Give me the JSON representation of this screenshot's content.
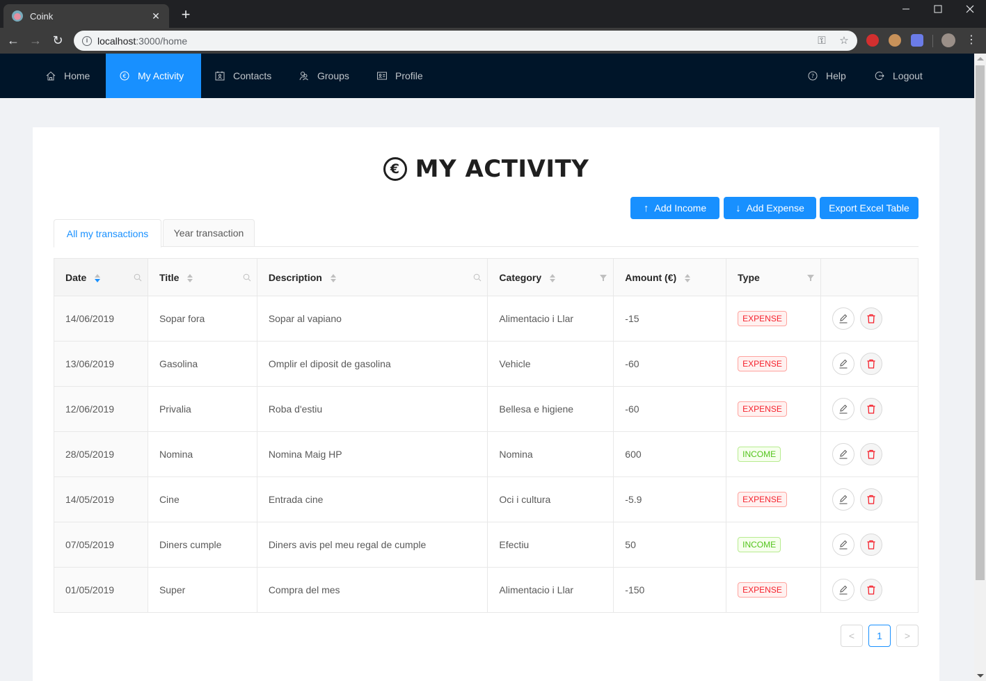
{
  "browser": {
    "tab_title": "Coink",
    "url_host": "localhost",
    "url_rest": ":3000/home"
  },
  "nav": {
    "items": [
      {
        "label": "Home",
        "icon": "home-icon"
      },
      {
        "label": "My Activity",
        "icon": "euro-circle-icon",
        "active": true
      },
      {
        "label": "Contacts",
        "icon": "contacts-icon"
      },
      {
        "label": "Groups",
        "icon": "team-icon"
      },
      {
        "label": "Profile",
        "icon": "idcard-icon"
      }
    ],
    "right": [
      {
        "label": "Help",
        "icon": "question-circle-icon"
      },
      {
        "label": "Logout",
        "icon": "logout-icon"
      }
    ]
  },
  "page": {
    "title": "MY ACTIVITY",
    "title_icon": "€"
  },
  "actions": {
    "add_income": "Add Income",
    "add_expense": "Add Expense",
    "export": "Export Excel Table"
  },
  "tabs": [
    {
      "label": "All my transactions",
      "active": true
    },
    {
      "label": "Year transaction",
      "active": false
    }
  ],
  "table": {
    "columns": [
      "Date",
      "Title",
      "Description",
      "Category",
      "Amount (€)",
      "Type"
    ],
    "rows": [
      {
        "date": "14/06/2019",
        "title": "Sopar fora",
        "description": "Sopar al vapiano",
        "category": "Alimentacio i Llar",
        "amount": "-15",
        "type": "EXPENSE"
      },
      {
        "date": "13/06/2019",
        "title": "Gasolina",
        "description": "Omplir el diposit de gasolina",
        "category": "Vehicle",
        "amount": "-60",
        "type": "EXPENSE"
      },
      {
        "date": "12/06/2019",
        "title": "Privalia",
        "description": "Roba d'estiu",
        "category": "Bellesa e higiene",
        "amount": "-60",
        "type": "EXPENSE"
      },
      {
        "date": "28/05/2019",
        "title": "Nomina",
        "description": "Nomina Maig HP",
        "category": "Nomina",
        "amount": "600",
        "type": "INCOME"
      },
      {
        "date": "14/05/2019",
        "title": "Cine",
        "description": "Entrada cine",
        "category": "Oci i cultura",
        "amount": "-5.9",
        "type": "EXPENSE"
      },
      {
        "date": "07/05/2019",
        "title": "Diners cumple",
        "description": "Diners avis pel meu regal de cumple",
        "category": "Efectiu",
        "amount": "50",
        "type": "INCOME"
      },
      {
        "date": "01/05/2019",
        "title": "Super",
        "description": "Compra del mes",
        "category": "Alimentacio i Llar",
        "amount": "-150",
        "type": "EXPENSE"
      }
    ]
  },
  "pagination": {
    "current": "1",
    "prev": "<",
    "next": ">"
  },
  "colors": {
    "primary": "#1890ff",
    "nav_bg": "#001529",
    "expense": "#f5222d",
    "income": "#52c41a"
  }
}
